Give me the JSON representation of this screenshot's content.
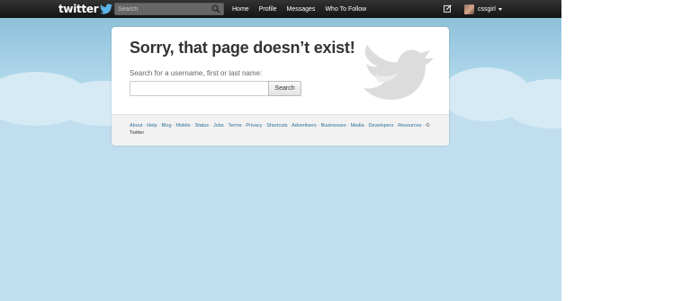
{
  "header": {
    "logo_text": "twitter",
    "search_placeholder": "Search",
    "nav": [
      "Home",
      "Profile",
      "Messages",
      "Who To Follow"
    ],
    "username": "cssgirl"
  },
  "error_card": {
    "title": "Sorry, that page doesn’t exist!",
    "prompt": "Search for a username, first or last name:",
    "search_button": "Search"
  },
  "footer": {
    "links": [
      "About",
      "Help",
      "Blog",
      "Mobile",
      "Status",
      "Jobs",
      "Terms",
      "Privacy",
      "Shortcuts",
      "Advertisers",
      "Businesses",
      "Media",
      "Developers",
      "Resources"
    ],
    "separator": "·",
    "copyright": "© Twitter"
  },
  "colors": {
    "topbar": "#1b1b1b",
    "sky": "#c0deed",
    "link": "#2b6f98"
  },
  "icons": [
    "twitter-bird-icon",
    "search-icon",
    "compose-icon",
    "chevron-down-icon",
    "twitter-bird-watermark"
  ]
}
